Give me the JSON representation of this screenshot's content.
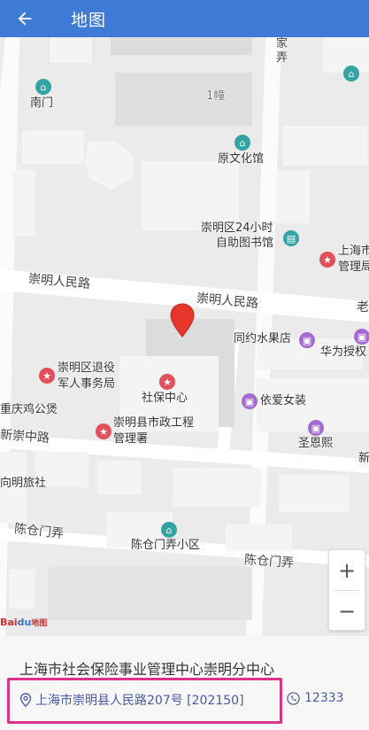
{
  "header": {
    "title": "地图",
    "back_icon": "back-arrow-icon"
  },
  "map": {
    "roads": {
      "chongming_renmin_lu_1": "崇明人民路",
      "chongming_renmin_lu_2": "崇明人民路",
      "xin_chongzhong_lu": "新崇中路",
      "chencangmen_nong_1": "陈仓门弄",
      "chencangmen_nong_2": "陈仓门弄",
      "jia_nong": "家弄"
    },
    "places": {
      "nanmen": "南门",
      "building1": "1幢",
      "yuanwenhuaguan": "原文化馆",
      "library_line1": "崇明区24小时",
      "library_line2": "自助图书馆",
      "shanghai_line1": "上海市",
      "shanghai_line2": "管理局",
      "tongyue_fruit": "同约水果店",
      "huawei": "华为授权",
      "veteran_line1": "崇明区退役",
      "veteran_line2": "军人事务局",
      "shebao": "社保中心",
      "chongqing_chicken": "重庆鸡公煲",
      "municipal_line1": "崇明县市政工程",
      "municipal_line2": "管理署",
      "yiai": "依爱女装",
      "shengenxi": "圣恩熙",
      "xiangming_hotel": "向明旅社",
      "chencang_community": "陈仓门弄小区",
      "lao": "老",
      "xin": "新"
    },
    "zoom_in": "+",
    "zoom_out": "−",
    "logo_text": "Bai",
    "logo_paw": "du",
    "logo_suffix": "地图"
  },
  "info": {
    "name": "上海市社会保险事业管理中心崇明分中心",
    "address": "上海市崇明县人民路207号 [202150]",
    "phone": "12333"
  },
  "colors": {
    "header": "#3d7bd6",
    "highlight": "#d9338b",
    "link": "#4a5aa8"
  }
}
